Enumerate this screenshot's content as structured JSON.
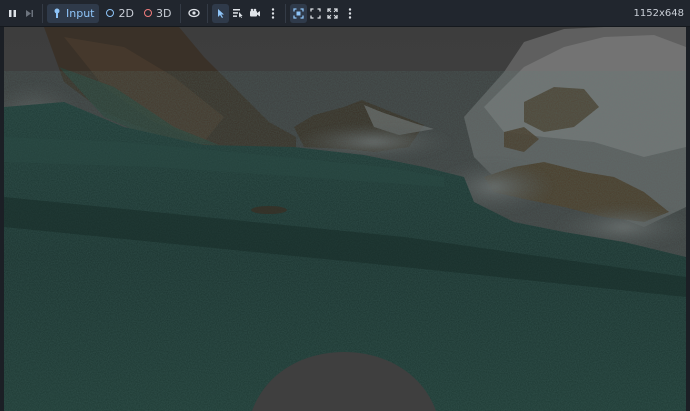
{
  "toolbar": {
    "pause_icon": "pause-icon",
    "step_icon": "step-forward-icon",
    "input_label": "Input",
    "mode_2d_label": "2D",
    "mode_3d_label": "3D",
    "resolution_text": "1152x648"
  },
  "colors": {
    "toolbar_bg": "#21262e",
    "accent": "#8ec4f8",
    "mode_3d_dot": "#f07c7c",
    "fog": "#3f3f3f",
    "water": "#1b3530"
  }
}
